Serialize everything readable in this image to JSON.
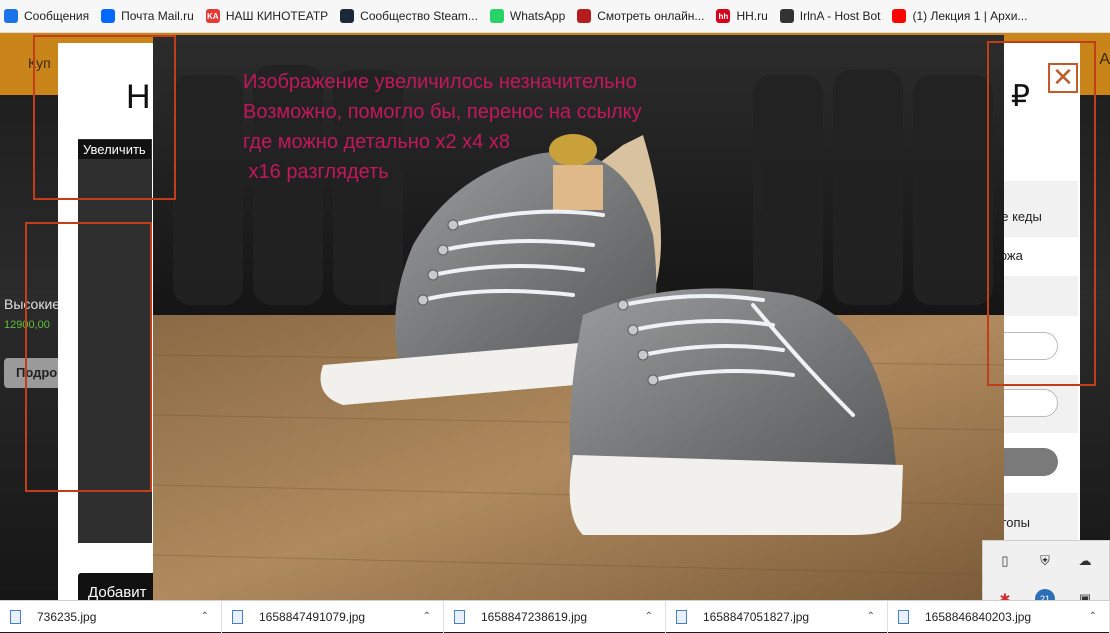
{
  "bookmarks": [
    {
      "label": "Сообщения",
      "icon": "message-icon",
      "color": "#1a73e8"
    },
    {
      "label": "Почта Mail.ru",
      "icon": "mail-icon",
      "color": "#0068ff"
    },
    {
      "label": "НАШ КИНОТЕАТР",
      "icon": "ka-icon",
      "color": "#e53935",
      "glyph": "KA"
    },
    {
      "label": "Сообщество Steam...",
      "icon": "steam-icon",
      "color": "#1b2838"
    },
    {
      "label": "WhatsApp",
      "icon": "whatsapp-icon",
      "color": "#25d366"
    },
    {
      "label": "Смотреть онлайн...",
      "icon": "cinema-icon",
      "color": "#b71c1c"
    },
    {
      "label": "HH.ru",
      "icon": "hh-icon",
      "color": "#d6001c",
      "glyph": "hh"
    },
    {
      "label": "IrlnA - Host Bot",
      "icon": "bot-icon",
      "color": "#333333"
    },
    {
      "label": "(1) Лекция 1 | Архи...",
      "icon": "youtube-icon",
      "color": "#ff0000"
    }
  ],
  "site": {
    "nav_label_left": "Куп",
    "nav_label_right": "А",
    "bg_product_name": "Высокие",
    "bg_product_price": "12900,00",
    "bg_button_label": "Подро"
  },
  "modal": {
    "title_fragment": "Н",
    "price_symbol": "₽",
    "close_glyph": "✕",
    "zoom_label": "Увеличить",
    "add_button_label": "Добавит",
    "right_panel": {
      "line1": "е",
      "line2": "ие кеды",
      "material": "кожа",
      "section_label": "стопы"
    }
  },
  "annotation": {
    "text": "Изображение увеличилось незначительно\nВозможно, помогло бы, перенос на ссылку\nгде можно детально x2 x4 x8\n x16 разглядеть",
    "color": "#c2185b"
  },
  "downloads": [
    {
      "name": "736235.jpg"
    },
    {
      "name": "1658847491079.jpg"
    },
    {
      "name": "1658847238619.jpg"
    },
    {
      "name": "1658847051827.jpg"
    },
    {
      "name": "1658846840203.jpg"
    }
  ],
  "tray": {
    "badge_count": "21"
  }
}
